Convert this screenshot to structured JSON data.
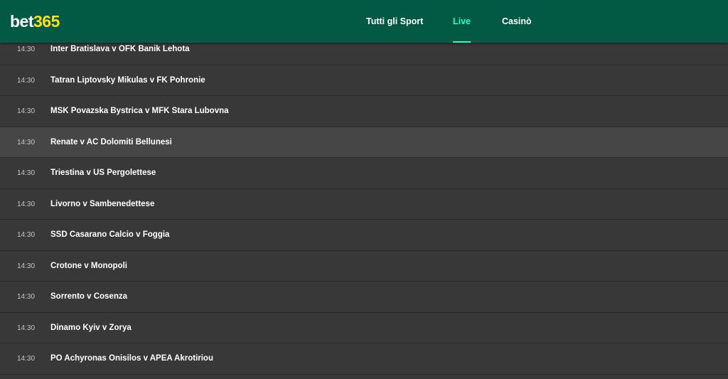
{
  "brand": {
    "logo_part1": "bet",
    "logo_part2": "365",
    "header_color": "#025a44",
    "logo_accent": "#ffdf1b",
    "active_color": "#26ffbe"
  },
  "nav": {
    "items": [
      {
        "label": "Tutti gli Sport",
        "active": false
      },
      {
        "label": "Live",
        "active": true
      },
      {
        "label": "Casinò",
        "active": false
      }
    ]
  },
  "events": [
    {
      "time": "14:30",
      "match": "Inter Bratislava v OFK Banik Lehota"
    },
    {
      "time": "14:30",
      "match": "Tatran Liptovsky Mikulas v FK Pohronie"
    },
    {
      "time": "14:30",
      "match": "MSK Povazska Bystrica v MFK Stara Lubovna"
    },
    {
      "time": "14:30",
      "match": "Renate v AC Dolomiti Bellunesi"
    },
    {
      "time": "14:30",
      "match": "Triestina v US Pergolettese"
    },
    {
      "time": "14:30",
      "match": "Livorno v Sambenedettese"
    },
    {
      "time": "14:30",
      "match": "SSD Casarano Calcio v Foggia"
    },
    {
      "time": "14:30",
      "match": "Crotone v Monopoli"
    },
    {
      "time": "14:30",
      "match": "Sorrento v Cosenza"
    },
    {
      "time": "14:30",
      "match": "Dinamo Kyiv v Zorya"
    },
    {
      "time": "14:30",
      "match": "PO Achyronas Onisilos v APEA Akrotiriou"
    }
  ]
}
